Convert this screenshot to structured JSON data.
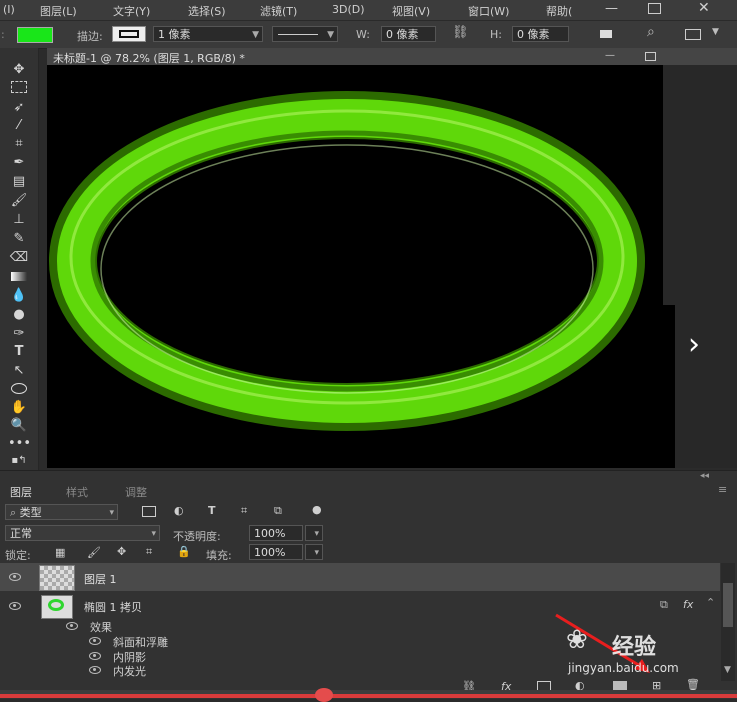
{
  "menubar": {
    "items": [
      "(I)",
      "图层(L)",
      "文字(Y)",
      "选择(S)",
      "滤镜(T)",
      "3D(D)",
      "视图(V)",
      "窗口(W)",
      "帮助("
    ]
  },
  "options": {
    "stroke_label": "描边:",
    "stroke_width": "1 像素",
    "w_label": "W:",
    "w_value": "0 像素",
    "h_label": "H:",
    "h_value": "0 像素",
    "fill_color": "#19e619"
  },
  "document": {
    "tab_title": "未标题-1 @ 78.2% (图层 1, RGB/8) *",
    "ring_color": "#5fd80a"
  },
  "panel": {
    "tabs": [
      "图层",
      "样式",
      "调整"
    ],
    "filter_label": "类型",
    "blend_mode": "正常",
    "opacity_label": "不透明度:",
    "opacity_value": "100%",
    "lock_label": "锁定:",
    "fill_label": "填充:",
    "fill_value": "100%",
    "layers": [
      {
        "name": "图层 1"
      },
      {
        "name": "椭圆 1 拷贝",
        "fx": "fx"
      }
    ],
    "effects_label": "效果",
    "effects": [
      "斜面和浮雕",
      "内阴影",
      "内发光"
    ]
  },
  "watermark": {
    "brand": "经验",
    "url": "jingyan.baidu.com"
  }
}
